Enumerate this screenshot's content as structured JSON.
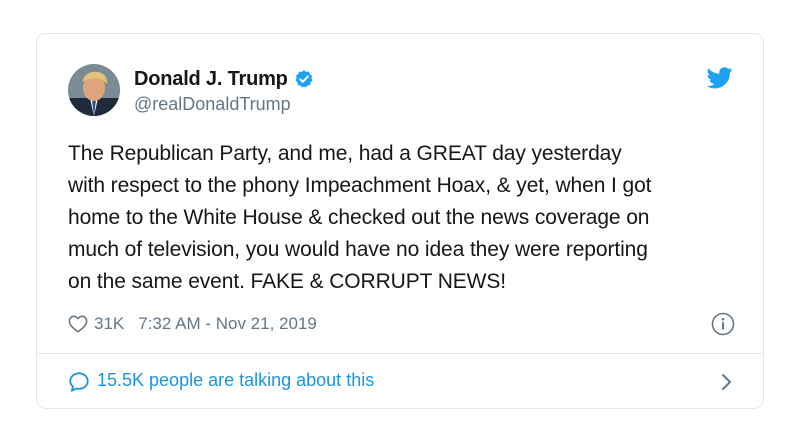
{
  "tweet": {
    "display_name": "Donald J. Trump",
    "handle": "@realDonaldTrump",
    "verified": true,
    "text_lines": [
      "The Republican Party, and me, had a GREAT day yesterday",
      "with respect to the phony Impeachment Hoax, & yet, when I got",
      "home to the White House & checked out the news coverage on",
      "much of television, you would have no idea they were reporting",
      "on the same event. FAKE & CORRUPT NEWS!"
    ],
    "likes": "31K",
    "timestamp": "7:32 AM - Nov 21, 2019",
    "conversation_label": "15.5K people are talking about this"
  },
  "icons": {
    "verified": "verified-badge-icon",
    "bird": "twitter-bird-icon",
    "heart": "heart-icon",
    "info": "info-icon",
    "bubble": "speech-bubble-icon",
    "chevron": "chevron-right-icon"
  },
  "colors": {
    "accent": "#1da1f2",
    "link": "#1b95e0",
    "muted": "#657786",
    "text": "#14171a",
    "border": "#e1e8ed"
  }
}
